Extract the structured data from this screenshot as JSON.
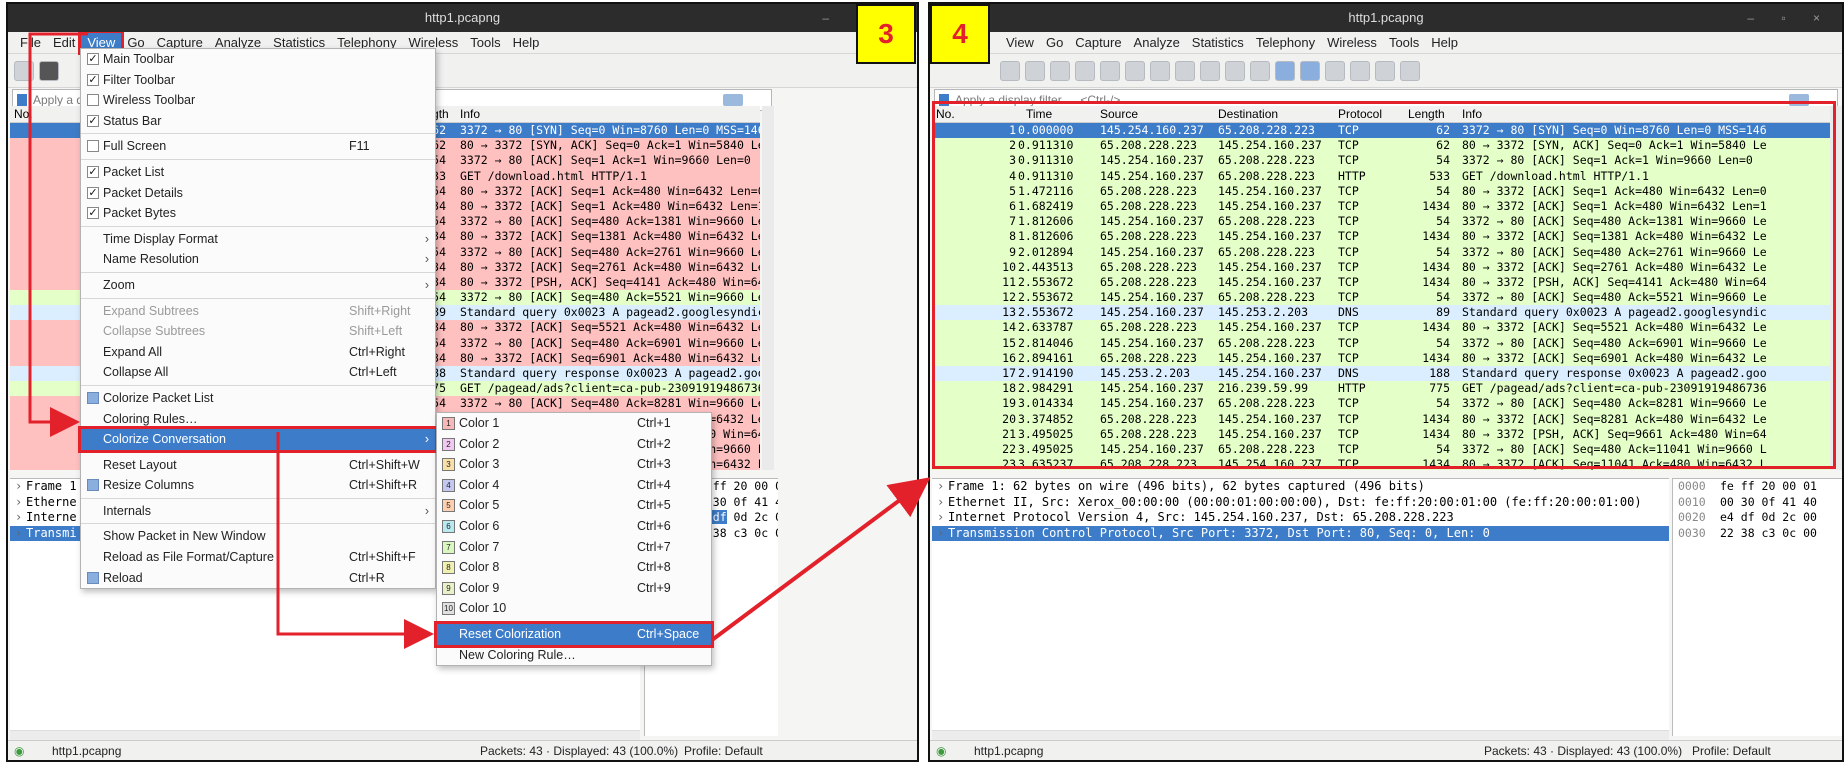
{
  "window_title": "http1.pcapng",
  "menubar_left": [
    "File",
    "Edit",
    "View",
    "Go",
    "Capture",
    "Analyze",
    "Statistics",
    "Telephony",
    "Wireless",
    "Tools",
    "Help"
  ],
  "menubar_right": [
    "View",
    "Go",
    "Capture",
    "Analyze",
    "Statistics",
    "Telephony",
    "Wireless",
    "Tools",
    "Help"
  ],
  "filter_left": "Apply a d",
  "filter_right": "Apply a display filter … <Ctrl-/>",
  "step_left": "3",
  "step_right": "4",
  "columns": {
    "no": "No.",
    "time": "Time",
    "source": "Source",
    "destination": "Destination",
    "protocol": "Protocol",
    "length": "Length",
    "info": "Info"
  },
  "left_columns": {
    "protocol": "otocol",
    "length": "Length",
    "info": "Info"
  },
  "packets": [
    {
      "no": "1",
      "time": "0.000000",
      "src": "145.254.160.237",
      "dst": "65.208.228.223",
      "proto": "TCP",
      "len": "62",
      "info": "3372 → 80 [SYN] Seq=0 Win=8760 Len=0 MSS=146",
      "cls": "sel"
    },
    {
      "no": "2",
      "time": "0.911310",
      "src": "65.208.228.223",
      "dst": "145.254.160.237",
      "proto": "TCP",
      "len": "62",
      "info": "80 → 3372 [SYN, ACK] Seq=0 Ack=1 Win=5840 Le",
      "cls": "tcpbad"
    },
    {
      "no": "3",
      "time": "0.911310",
      "src": "145.254.160.237",
      "dst": "65.208.228.223",
      "proto": "TCP",
      "len": "54",
      "info": "3372 → 80 [ACK] Seq=1 Ack=1 Win=9660 Len=0",
      "cls": "tcpbad"
    },
    {
      "no": "4",
      "time": "0.911310",
      "src": "145.254.160.237",
      "dst": "65.208.228.223",
      "proto": "HTTP",
      "len": "533",
      "info": "GET /download.html HTTP/1.1",
      "cls": "tcpbad"
    },
    {
      "no": "5",
      "time": "1.472116",
      "src": "65.208.228.223",
      "dst": "145.254.160.237",
      "proto": "TCP",
      "len": "54",
      "info": "80 → 3372 [ACK] Seq=1 Ack=480 Win=6432 Len=0",
      "cls": "tcpbad"
    },
    {
      "no": "6",
      "time": "1.682419",
      "src": "65.208.228.223",
      "dst": "145.254.160.237",
      "proto": "TCP",
      "len": "1434",
      "info": "80 → 3372 [ACK] Seq=1 Ack=480 Win=6432 Len=1",
      "cls": "tcpbad"
    },
    {
      "no": "7",
      "time": "1.812606",
      "src": "145.254.160.237",
      "dst": "65.208.228.223",
      "proto": "TCP",
      "len": "54",
      "info": "3372 → 80 [ACK] Seq=480 Ack=1381 Win=9660 Le",
      "cls": "tcpbad"
    },
    {
      "no": "8",
      "time": "1.812606",
      "src": "65.208.228.223",
      "dst": "145.254.160.237",
      "proto": "TCP",
      "len": "1434",
      "info": "80 → 3372 [ACK] Seq=1381 Ack=480 Win=6432 Le",
      "cls": "tcpbad"
    },
    {
      "no": "9",
      "time": "2.012894",
      "src": "145.254.160.237",
      "dst": "65.208.228.223",
      "proto": "TCP",
      "len": "54",
      "info": "3372 → 80 [ACK] Seq=480 Ack=2761 Win=9660 Le",
      "cls": "tcpbad"
    },
    {
      "no": "10",
      "time": "2.443513",
      "src": "65.208.228.223",
      "dst": "145.254.160.237",
      "proto": "TCP",
      "len": "1434",
      "info": "80 → 3372 [ACK] Seq=2761 Ack=480 Win=6432 Le",
      "cls": "tcpbad"
    },
    {
      "no": "11",
      "time": "2.553672",
      "src": "65.208.228.223",
      "dst": "145.254.160.237",
      "proto": "TCP",
      "len": "1434",
      "info": "80 → 3372 [PSH, ACK] Seq=4141 Ack=480 Win=64",
      "cls": "tcpbad"
    },
    {
      "no": "12",
      "time": "2.553672",
      "src": "145.254.160.237",
      "dst": "65.208.228.223",
      "proto": "TCP",
      "len": "54",
      "info": "3372 → 80 [ACK] Seq=480 Ack=5521 Win=9660 Le",
      "cls": "tcp"
    },
    {
      "no": "13",
      "time": "2.553672",
      "src": "145.254.160.237",
      "dst": "145.253.2.203",
      "proto": "DNS",
      "len": "89",
      "info": "Standard query 0x0023 A pagead2.googlesyndic",
      "cls": "dns"
    },
    {
      "no": "14",
      "time": "2.633787",
      "src": "65.208.228.223",
      "dst": "145.254.160.237",
      "proto": "TCP",
      "len": "1434",
      "info": "80 → 3372 [ACK] Seq=5521 Ack=480 Win=6432 Le",
      "cls": "tcpbad"
    },
    {
      "no": "15",
      "time": "2.814046",
      "src": "145.254.160.237",
      "dst": "65.208.228.223",
      "proto": "TCP",
      "len": "54",
      "info": "3372 → 80 [ACK] Seq=480 Ack=6901 Win=9660 Le",
      "cls": "tcpbad"
    },
    {
      "no": "16",
      "time": "2.894161",
      "src": "65.208.228.223",
      "dst": "145.254.160.237",
      "proto": "TCP",
      "len": "1434",
      "info": "80 → 3372 [ACK] Seq=6901 Ack=480 Win=6432 Le",
      "cls": "tcpbad"
    },
    {
      "no": "17",
      "time": "2.914190",
      "src": "145.253.2.203",
      "dst": "145.254.160.237",
      "proto": "DNS",
      "len": "188",
      "info": "Standard query response 0x0023 A pagead2.goo",
      "cls": "dns"
    },
    {
      "no": "18",
      "time": "2.984291",
      "src": "145.254.160.237",
      "dst": "216.239.59.99",
      "proto": "HTTP",
      "len": "775",
      "info": "GET /pagead/ads?client=ca-pub-23091919486736",
      "cls": "http"
    },
    {
      "no": "19",
      "time": "3.014334",
      "src": "145.254.160.237",
      "dst": "65.208.228.223",
      "proto": "TCP",
      "len": "54",
      "info": "3372 → 80 [ACK] Seq=480 Ack=8281 Win=9660 Le",
      "cls": "tcpbad"
    },
    {
      "no": "20",
      "time": "3.374852",
      "src": "65.208.228.223",
      "dst": "145.254.160.237",
      "proto": "TCP",
      "len": "1434",
      "info": "80 → 3372 [ACK] Seq=8281 Ack=480 Win=6432 Le",
      "cls": "tcpbad"
    },
    {
      "no": "21",
      "time": "3.495025",
      "src": "65.208.228.223",
      "dst": "145.254.160.237",
      "proto": "TCP",
      "len": "1434",
      "info": "80 → 3372 [PSH, ACK] Seq=9661 Ack=480 Win=64",
      "cls": "tcpbad"
    },
    {
      "no": "22",
      "time": "3.495025",
      "src": "145.254.160.237",
      "dst": "65.208.228.223",
      "proto": "TCP",
      "len": "54",
      "info": "3372 → 80 [ACK] Seq=480 Ack=11041 Win=9660 L",
      "cls": "tcpbad"
    },
    {
      "no": "23",
      "time": "3.635237",
      "src": "65.208.228.223",
      "dst": "145.254.160.237",
      "proto": "TCP",
      "len": "1434",
      "info": "80 → 3372 [ACK] Seq=11041 Ack=480 Win=6432 L",
      "cls": "tcpbad"
    }
  ],
  "details_right": [
    "Frame 1: 62 bytes on wire (496 bits), 62 bytes captured (496 bits)",
    "Ethernet II, Src: Xerox_00:00:00 (00:00:01:00:00:00), Dst: fe:ff:20:00:01:00 (fe:ff:20:00:01:00)",
    "Internet Protocol Version 4, Src: 145.254.160.237, Dst: 65.208.228.223",
    "Transmission Control Protocol, Src Port: 3372, Dst Port: 80, Seq: 0, Len: 0"
  ],
  "details_left": [
    "Frame 1",
    "Etherne",
    "Interne",
    "Transmi"
  ],
  "details_left_tail": [
    "",
    ":01:00)",
    "",
    ""
  ],
  "bytes": [
    {
      "off": "0000",
      "hex": "fe ff 20 00 01"
    },
    {
      "off": "0010",
      "hex": "00 30 0f 41 40"
    },
    {
      "off": "0020",
      "hex": "e4 df 0d 2c 00"
    },
    {
      "off": "0030",
      "hex": "22 38 c3 0c 00"
    }
  ],
  "bytes_left_0020_hl": "e4 df",
  "bytes_left_0020_rest": " 0d 2c 0c",
  "bytes_left_0030": "22 38 c3 0c 00",
  "status": {
    "file": "http1.pcapng",
    "packets": "Packets: 43 · Displayed: 43 (100.0%)",
    "profile": "Profile: Default"
  },
  "view_menu": [
    {
      "label": "Main Toolbar",
      "check": "on"
    },
    {
      "label": "Filter Toolbar",
      "check": "on"
    },
    {
      "label": "Wireless Toolbar",
      "check": "off"
    },
    {
      "label": "Status Bar",
      "check": "on"
    },
    {
      "sep": true
    },
    {
      "label": "Full Screen",
      "check": "off",
      "shortcut": "F11"
    },
    {
      "sep": true
    },
    {
      "label": "Packet List",
      "check": "on"
    },
    {
      "label": "Packet Details",
      "check": "on"
    },
    {
      "label": "Packet Bytes",
      "check": "on"
    },
    {
      "sep": true
    },
    {
      "label": "Time Display Format",
      "arrow": true
    },
    {
      "label": "Name Resolution",
      "arrow": true
    },
    {
      "sep": true
    },
    {
      "label": "Zoom",
      "arrow": true
    },
    {
      "sep": true
    },
    {
      "label": "Expand Subtrees",
      "shortcut": "Shift+Right",
      "disabled": true
    },
    {
      "label": "Collapse Subtrees",
      "shortcut": "Shift+Left",
      "disabled": true
    },
    {
      "label": "Expand All",
      "shortcut": "Ctrl+Right"
    },
    {
      "label": "Collapse All",
      "shortcut": "Ctrl+Left"
    },
    {
      "sep": true
    },
    {
      "label": "Colorize Packet List",
      "icon": true
    },
    {
      "label": "Coloring Rules…"
    },
    {
      "label": "Colorize Conversation",
      "arrow": true,
      "highlight": true
    },
    {
      "sep": true
    },
    {
      "label": "Reset Layout",
      "shortcut": "Ctrl+Shift+W"
    },
    {
      "label": "Resize Columns",
      "shortcut": "Ctrl+Shift+R",
      "icon": true
    },
    {
      "sep": true
    },
    {
      "label": "Internals",
      "arrow": true
    },
    {
      "sep": true
    },
    {
      "label": "Show Packet in New Window"
    },
    {
      "label": "Reload as File Format/Capture",
      "shortcut": "Ctrl+Shift+F"
    },
    {
      "label": "Reload",
      "shortcut": "Ctrl+R",
      "icon": true
    }
  ],
  "conv_menu": [
    {
      "n": "1",
      "label": "Color 1",
      "shortcut": "Ctrl+1",
      "color": "#f7b8b8"
    },
    {
      "n": "2",
      "label": "Color 2",
      "shortcut": "Ctrl+2",
      "color": "#f0c8f0"
    },
    {
      "n": "3",
      "label": "Color 3",
      "shortcut": "Ctrl+3",
      "color": "#f9e0a8"
    },
    {
      "n": "4",
      "label": "Color 4",
      "shortcut": "Ctrl+4",
      "color": "#c4c8f0"
    },
    {
      "n": "5",
      "label": "Color 5",
      "shortcut": "Ctrl+5",
      "color": "#ffd0b0"
    },
    {
      "n": "6",
      "label": "Color 6",
      "shortcut": "Ctrl+6",
      "color": "#b8e8f0"
    },
    {
      "n": "7",
      "label": "Color 7",
      "shortcut": "Ctrl+7",
      "color": "#d8f8c0"
    },
    {
      "n": "8",
      "label": "Color 8",
      "shortcut": "Ctrl+8",
      "color": "#f0f0b0"
    },
    {
      "n": "9",
      "label": "Color 9",
      "shortcut": "Ctrl+9",
      "color": "#e8f0c8"
    },
    {
      "n": "10",
      "label": "Color 10",
      "shortcut": "",
      "color": "#e0e0e0"
    },
    {
      "sep": true
    },
    {
      "label": "Reset Colorization",
      "shortcut": "Ctrl+Space",
      "highlight": true
    },
    {
      "label": "New Coloring Rule…"
    }
  ],
  "colors": {
    "selection": "#3d7cc9",
    "annotation_red": "#e2212a",
    "step_yellow": "#ffff00",
    "tcp_green": "#e4ffc7",
    "bad_red": "#ffc0c0",
    "dns_blue": "#daeeff"
  }
}
